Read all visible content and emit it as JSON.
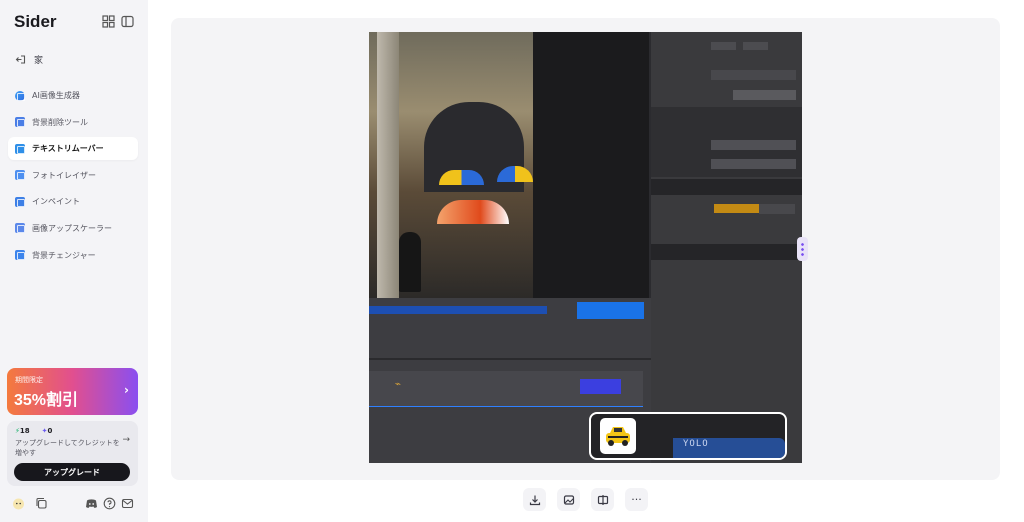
{
  "brand": "Sider",
  "sidebar": {
    "home_label": "家",
    "items": [
      {
        "label": "AI画像生成器",
        "icon": "ai-image-icon",
        "active": false
      },
      {
        "label": "背景削除ツール",
        "icon": "background-remover-icon",
        "active": false
      },
      {
        "label": "テキストリムーバー",
        "icon": "text-remover-icon",
        "active": true
      },
      {
        "label": "フォトイレイザー",
        "icon": "photo-eraser-icon",
        "active": false
      },
      {
        "label": "インペイント",
        "icon": "inpaint-icon",
        "active": false
      },
      {
        "label": "画像アップスケーラー",
        "icon": "upscaler-icon",
        "active": false
      },
      {
        "label": "背景チェンジャー",
        "icon": "background-changer-icon",
        "active": false
      }
    ],
    "promo": {
      "subtitle": "期間限定",
      "title": "35%割引",
      "arrow": "›"
    },
    "credits": {
      "bolt": "18",
      "gem": "0",
      "text": "アップグレードしてクレジットを増やす",
      "arrow": "→"
    },
    "upgrade_label": "アップグレード"
  },
  "thumbnail": {
    "label": "YOLO"
  },
  "toolbar": {
    "more": "···"
  },
  "colors": {
    "accent": "#1a73e8",
    "promo_start": "#f47a3d",
    "promo_end": "#8a4ff0",
    "handle": "#7a4ff0"
  }
}
